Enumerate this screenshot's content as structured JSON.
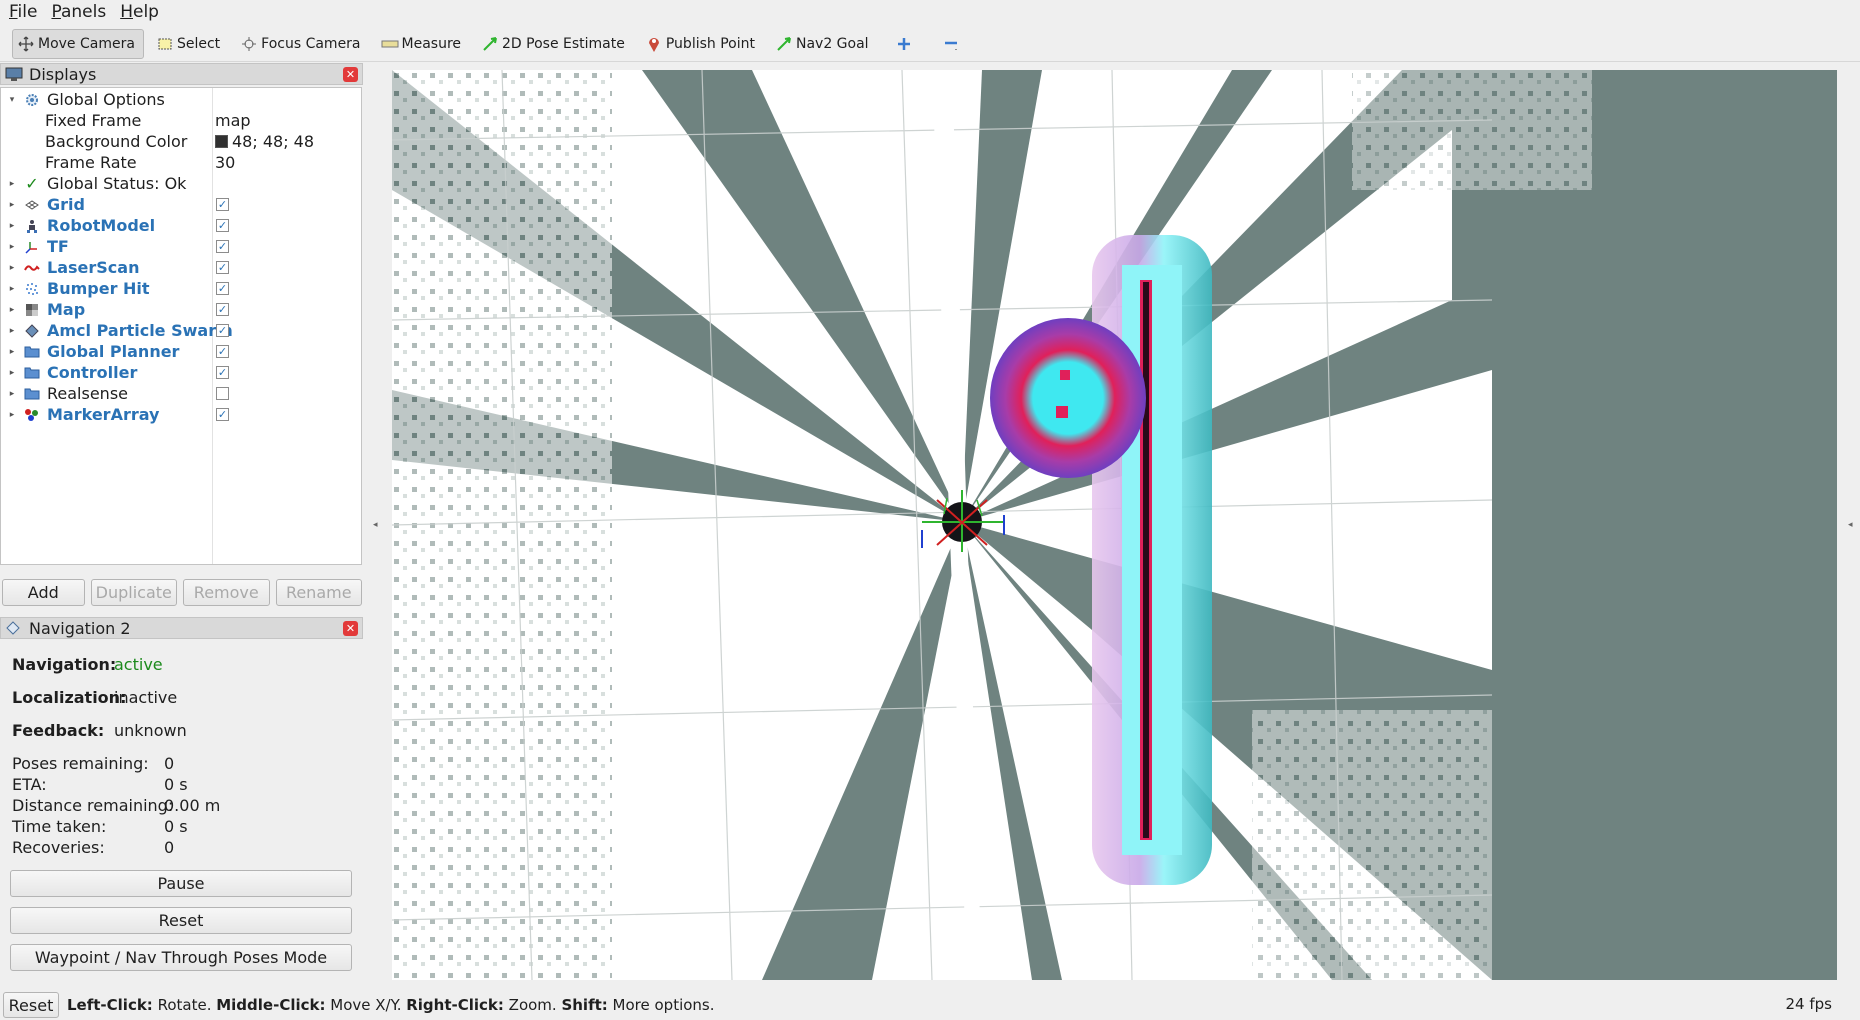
{
  "menubar": {
    "items": [
      "File",
      "Panels",
      "Help"
    ]
  },
  "toolbar": {
    "tools": [
      {
        "label": "Move Camera",
        "icon": "move-camera-icon"
      },
      {
        "label": "Select",
        "icon": "select-icon"
      },
      {
        "label": "Focus Camera",
        "icon": "focus-camera-icon"
      },
      {
        "label": "Measure",
        "icon": "measure-icon"
      },
      {
        "label": "2D Pose Estimate",
        "icon": "pose-estimate-icon"
      },
      {
        "label": "Publish Point",
        "icon": "publish-point-icon"
      },
      {
        "label": "Nav2 Goal",
        "icon": "nav2-goal-icon"
      }
    ]
  },
  "displays": {
    "title": "Displays",
    "global_options": {
      "label": "Global Options",
      "fixed_frame_label": "Fixed Frame",
      "fixed_frame_value": "map",
      "bg_color_label": "Background Color",
      "bg_color_value": "48; 48; 48",
      "frame_rate_label": "Frame Rate",
      "frame_rate_value": "30"
    },
    "global_status": "Global Status: Ok",
    "items": [
      {
        "label": "Grid",
        "checked": true
      },
      {
        "label": "RobotModel",
        "checked": true
      },
      {
        "label": "TF",
        "checked": true
      },
      {
        "label": "LaserScan",
        "checked": true
      },
      {
        "label": "Bumper Hit",
        "checked": true
      },
      {
        "label": "Map",
        "checked": true
      },
      {
        "label": "Amcl Particle Swarm",
        "checked": true
      },
      {
        "label": "Global Planner",
        "checked": true
      },
      {
        "label": "Controller",
        "checked": true
      },
      {
        "label": "Realsense",
        "checked": false
      },
      {
        "label": "MarkerArray",
        "checked": true
      }
    ],
    "buttons": {
      "add": "Add",
      "duplicate": "Duplicate",
      "remove": "Remove",
      "rename": "Rename"
    }
  },
  "navigation": {
    "title": "Navigation 2",
    "navigation_label": "Navigation:",
    "navigation_value": "active",
    "localization_label": "Localization:",
    "localization_value": "inactive",
    "feedback_label": "Feedback:",
    "feedback_value": "unknown",
    "poses_label": "Poses remaining:",
    "poses_value": "0",
    "eta_label": "ETA:",
    "eta_value": "0 s",
    "distance_label": "Distance remaining:",
    "distance_value": "0.00 m",
    "time_label": "Time taken:",
    "time_value": "0 s",
    "recoveries_label": "Recoveries:",
    "recoveries_value": "0",
    "pause_button": "Pause",
    "reset_button": "Reset",
    "waypoint_button": "Waypoint / Nav Through Poses Mode"
  },
  "statusbar": {
    "reset_button": "Reset",
    "hint_parts": [
      {
        "bold": "Left-Click:",
        "text": " Rotate. "
      },
      {
        "bold": "Middle-Click:",
        "text": " Move X/Y. "
      },
      {
        "bold": "Right-Click:",
        "text": ":"
      },
      {
        "bold": "Shift:",
        "text": " More options."
      }
    ],
    "left_click": "Left-Click:",
    "left_click_action": " Rotate. ",
    "middle_click": "Middle-Click:",
    "middle_click_action": " Move X/Y. ",
    "right_click": "Right-Click:",
    "right_click_action": " Zoom. ",
    "shift": "Shift:",
    "shift_action": " More options.",
    "fps": "24 fps"
  },
  "colors": {
    "map_unknown": "#6f8380",
    "map_free": "#ffffff",
    "costmap_cyan": "#3fe8f0",
    "costmap_magenta": "#e0205a",
    "costmap_purple": "#8a40c8",
    "status_active": "#1c8a1c"
  }
}
